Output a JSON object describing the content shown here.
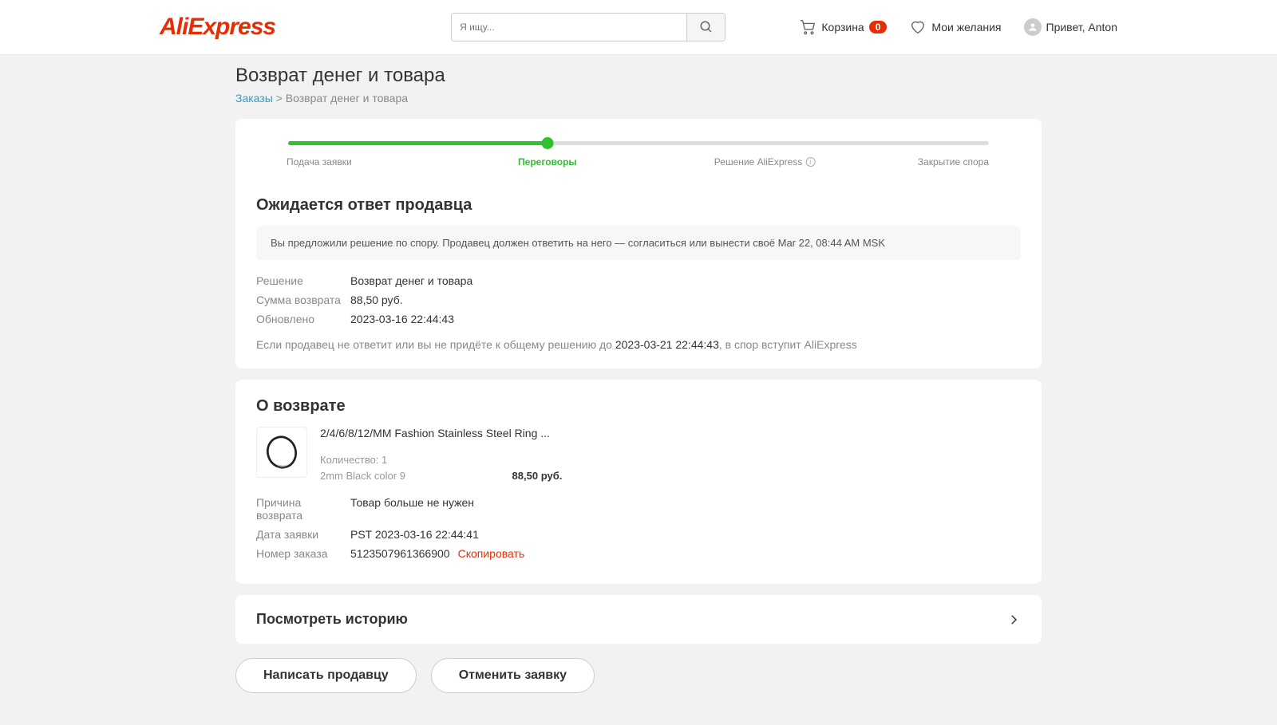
{
  "header": {
    "logo": "AliExpress",
    "search_placeholder": "Я ищу...",
    "cart_label": "Корзина",
    "cart_count": "0",
    "wishlist_label": "Мои желания",
    "greeting": "Привет, Anton"
  },
  "page": {
    "title": "Возврат денег и товара",
    "breadcrumb_link": "Заказы",
    "breadcrumb_sep": " > ",
    "breadcrumb_current": "Возврат денег и товара"
  },
  "progress": {
    "steps": [
      "Подача заявки",
      "Переговоры",
      "Решение AliExpress",
      "Закрытие спора"
    ],
    "active_index": 1
  },
  "status": {
    "heading": "Ожидается ответ продавца",
    "notice": "Вы предложили решение по спору. Продавец должен ответить на него — согласиться или вынести своё Mar 22, 08:44 AM MSK",
    "rows": {
      "decision_k": "Решение",
      "decision_v": "Возврат денег и товара",
      "amount_k": "Сумма возврата",
      "amount_v": "88,50 руб.",
      "updated_k": "Обновлено",
      "updated_v": "2023-03-16 22:44:43"
    },
    "note_before": "Если продавец не ответит или вы не придёте к общему решению до ",
    "note_date": "2023-03-21 22:44:43",
    "note_after": ", в спор вступит AliExpress"
  },
  "about": {
    "heading": "О возврате",
    "product_title": "2/4/6/8/12/MM Fashion Stainless Steel Ring ...",
    "qty_label": "Количество: 1",
    "variant": "2mm Black color 9",
    "price": "88,50 руб.",
    "rows": {
      "reason_k": "Причина возврата",
      "reason_v": "Товар больше не нужен",
      "date_k": "Дата заявки",
      "date_v": "PST 2023-03-16 22:44:41",
      "order_k": "Номер заказа",
      "order_v": "5123507961366900"
    },
    "copy_label": "Скопировать"
  },
  "history": {
    "label": "Посмотреть историю"
  },
  "actions": {
    "message_seller": "Написать продавцу",
    "cancel_request": "Отменить заявку"
  }
}
